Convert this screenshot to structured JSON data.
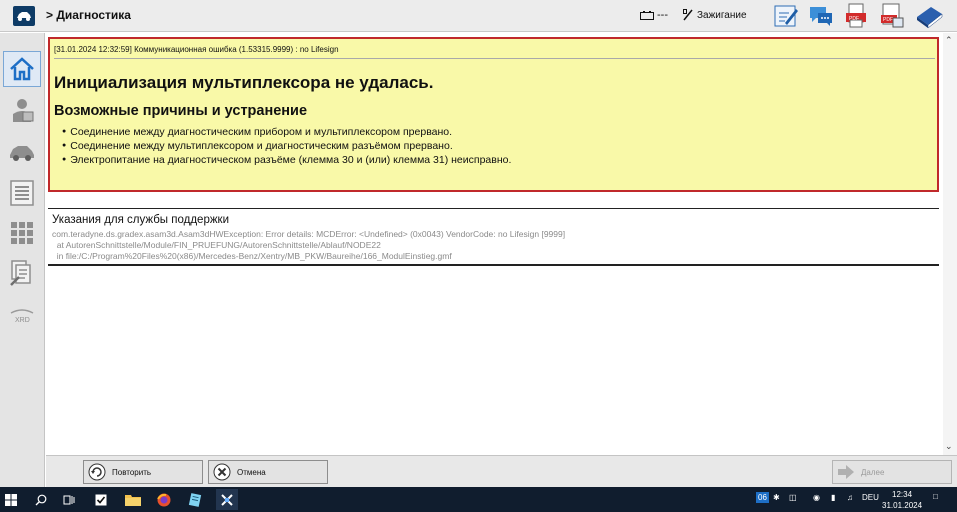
{
  "header": {
    "breadcrumb": "> Диагностика",
    "battery_value": "---",
    "ignition_label": "Зажигание",
    "toolbar_icons": [
      "annotate-icon",
      "chat-icon",
      "pdf-print-icon",
      "pdf-export-icon",
      "manual-book-icon"
    ]
  },
  "sidebar": {
    "items": [
      {
        "icon": "home-icon",
        "active": true
      },
      {
        "icon": "operator-icon",
        "active": false
      },
      {
        "icon": "vehicle-icon",
        "active": false
      },
      {
        "icon": "list-icon",
        "active": false
      },
      {
        "icon": "control-units-grid-icon",
        "active": false
      },
      {
        "icon": "documents-wrench-icon",
        "active": false
      },
      {
        "icon": "xrd-icon",
        "active": false,
        "label": "XRD"
      }
    ]
  },
  "error": {
    "log_line": "[31.01.2024 12:32:59] Коммуникационная ошибка (1.53315.9999) : no Lifesign",
    "title": "Инициализация мультиплексора не удалась.",
    "subtitle": "Возможные причины и устранение",
    "causes": [
      "Соединение между диагностическим прибором и мультиплексором прервано.",
      "Соединение между мультиплексором и диагностическим разъёмом прервано.",
      "Электропитание на диагностическом разъёме (клемма 30 и (или) клемма 31) неисправно."
    ]
  },
  "support": {
    "title": "Указания для службы поддержки",
    "lines": [
      "com.teradyne.ds.gradex.asam3d.Asam3dHWException: Error details: MCDError: <Undefined> (0x0043) VendorCode: no Lifesign [9999]",
      "  at AutorenSchnittstelle/Module/FIN_PRUEFUNG/AutorenSchnittstelle/Ablauf/NODE22",
      "  in file:/C:/Program%20Files%20(x86)/Mercedes-Benz/Xentry/MB_PKW/Baureihe/166_ModulEinstieg.gmf"
    ]
  },
  "actions": {
    "repeat_label": "Повторить",
    "cancel_label": "Отмена",
    "next_label": "Далее"
  },
  "taskbar": {
    "lang": "DEU",
    "time": "12:34",
    "date": "31.01.2024",
    "tray_badge": "06"
  },
  "colors": {
    "error_background": "#f9f9a8",
    "error_border": "#c0292b",
    "taskbar": "#101d2e",
    "accent": "#1e6fc6"
  }
}
